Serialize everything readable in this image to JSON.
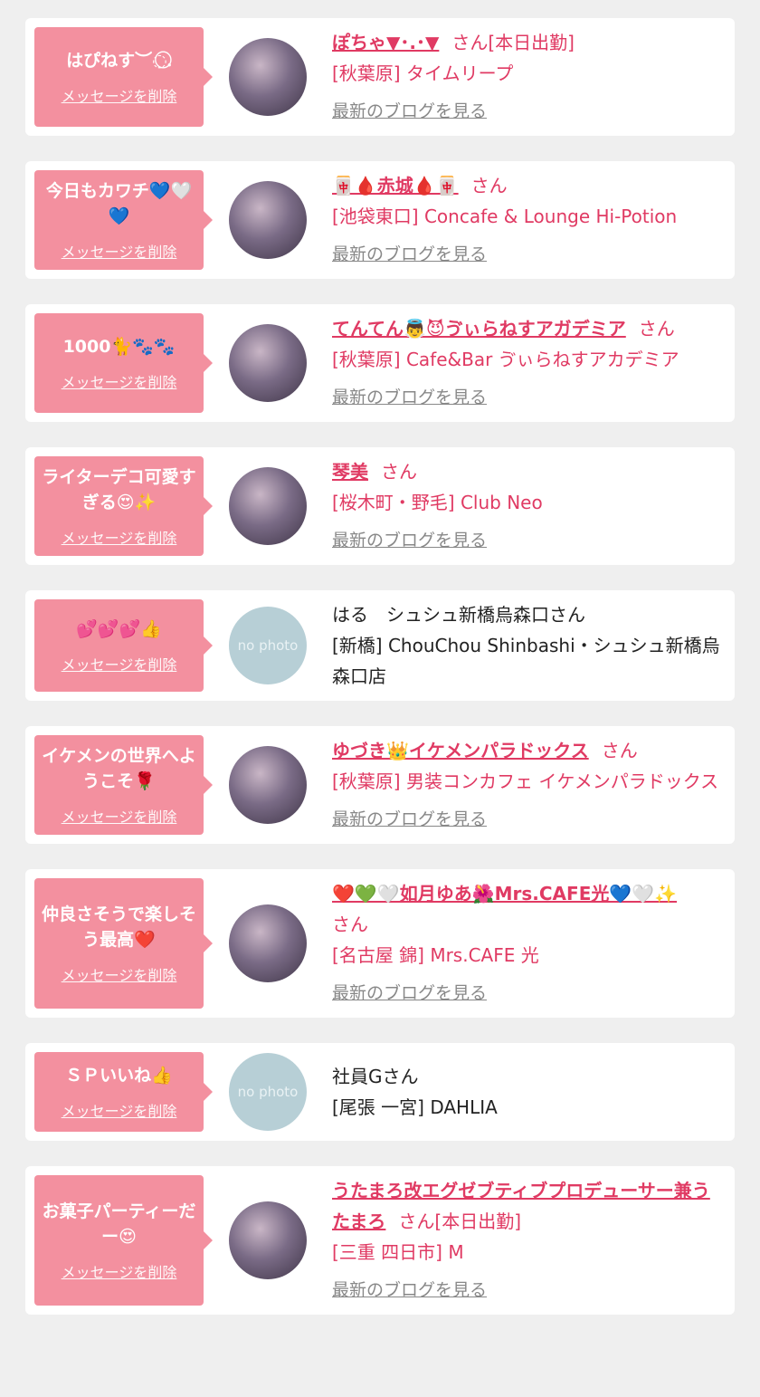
{
  "items": [
    {
      "message": "はぴねす︶◌.⃝",
      "delete_label": "メッセージを削除",
      "name": "ぽちゃ▼･.･▼",
      "san": "さん[本日出勤]",
      "shop": "[秋葉原] タイムリープ",
      "blog_label": "最新のブログを見る",
      "avatar": "photo"
    },
    {
      "message": "今日もカワチ💙🤍💙",
      "delete_label": "メッセージを削除",
      "name": "🀄🩸赤城🩸🀄",
      "san": "さん",
      "shop": "[池袋東口] Concafe & Lounge Hi-Potion",
      "blog_label": "最新のブログを見る",
      "avatar": "photo"
    },
    {
      "message": "1000🐈🐾🐾",
      "delete_label": "メッセージを削除",
      "name": "てんてん👼😈ゔぃらねすアガデミア",
      "san": "さん",
      "shop": "[秋葉原] Cafe&Bar ゔぃらねすアカデミア",
      "blog_label": "最新のブログを見る",
      "avatar": "photo"
    },
    {
      "message": "ライターデコ可愛すぎる😍✨",
      "delete_label": "メッセージを削除",
      "name": "琴美",
      "san": "さん",
      "shop": "[桜木町・野毛] Club Neo",
      "blog_label": "最新のブログを見る",
      "avatar": "photo"
    },
    {
      "message": "💕💕💕👍",
      "delete_label": "メッセージを削除",
      "name_plain": "はる　シュシュ新橋烏森口さん",
      "shop_plain": "[新橋] ChouChou Shinbashi・シュシュ新橋烏森口店",
      "avatar": "nophoto",
      "avatar_text": "no photo"
    },
    {
      "message": "イケメンの世界へようこそ🌹",
      "delete_label": "メッセージを削除",
      "name": "ゆづき👑イケメンパラドックス",
      "san": "さん",
      "shop": "[秋葉原] 男装コンカフェ イケメンパラドックス",
      "blog_label": "最新のブログを見る",
      "avatar": "photo"
    },
    {
      "message": "仲良さそうで楽しそう最高❤️",
      "delete_label": "メッセージを削除",
      "name": "❤️💚🤍如月ゆあ🌺Mrs.CAFE光💙🤍✨",
      "san": "さん",
      "shop": "[名古屋 錦] Mrs.CAFE 光",
      "blog_label": "最新のブログを見る",
      "avatar": "photo"
    },
    {
      "message": "ＳＰいいね👍",
      "delete_label": "メッセージを削除",
      "name_plain": "社員Gさん",
      "shop_plain": "[尾張 一宮] DAHLIA",
      "avatar": "nophoto",
      "avatar_text": "no photo"
    },
    {
      "message": "お菓子パーティーだー😍",
      "delete_label": "メッセージを削除",
      "name": "うたまろ改エグゼブティブプロデューサー兼うたまろ",
      "san": "さん[本日出勤]",
      "shop": "[三重 四日市] M",
      "blog_label": "最新のブログを見る",
      "avatar": "photo"
    }
  ]
}
